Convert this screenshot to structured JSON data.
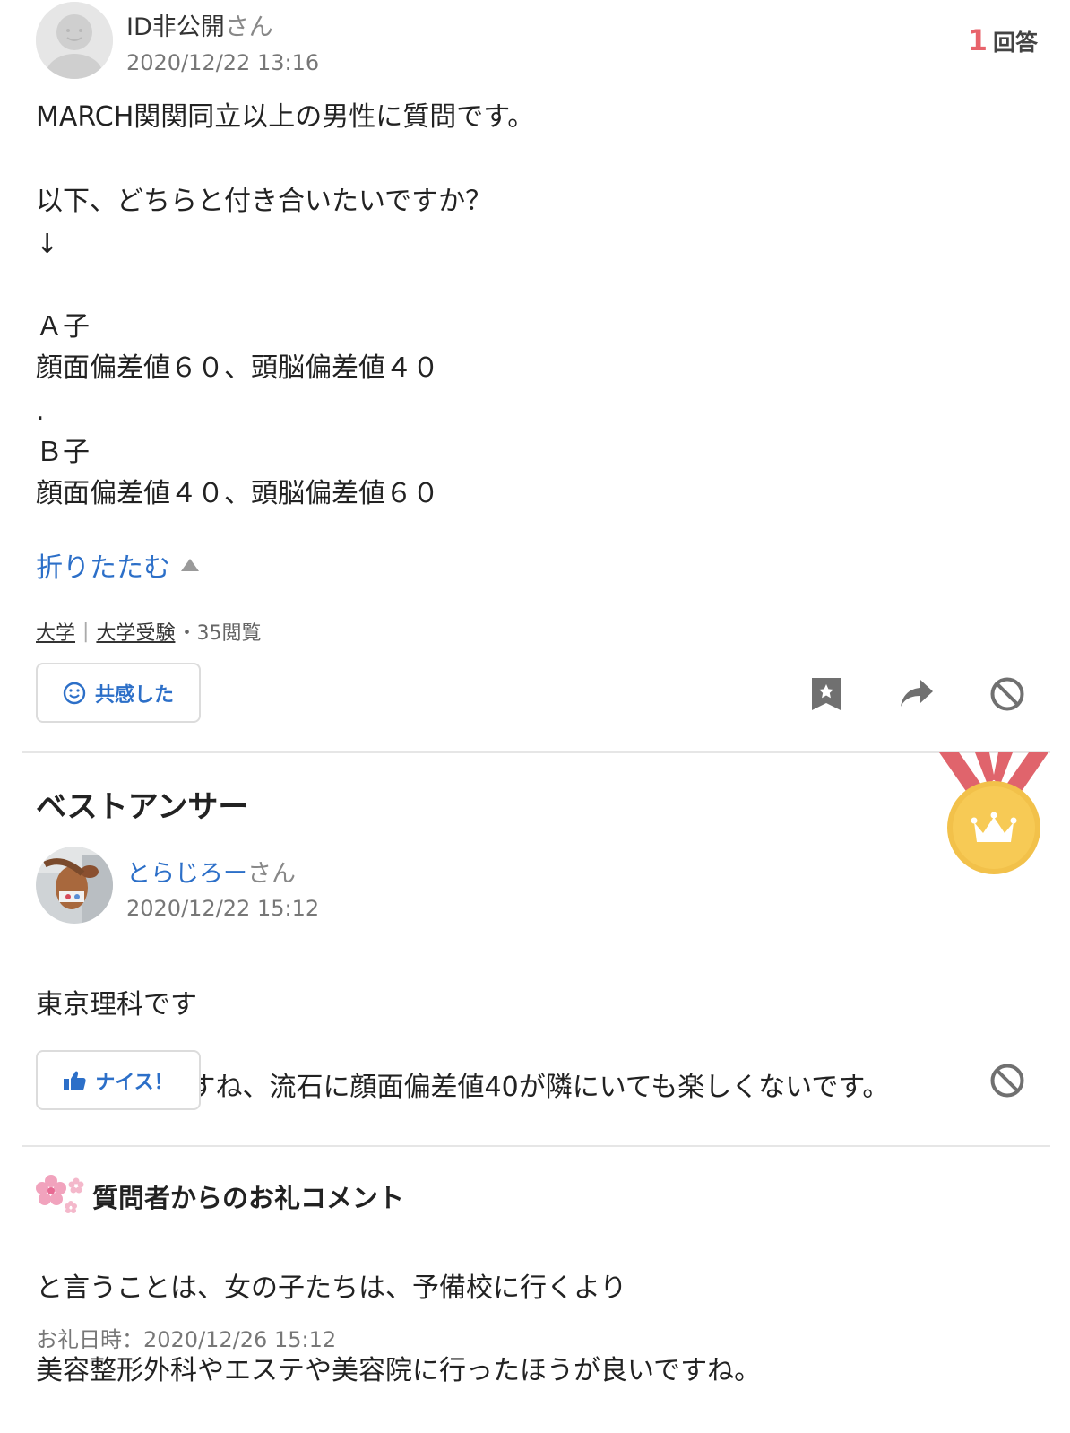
{
  "question": {
    "user_name": "ID非公開",
    "user_suffix": "さん",
    "timestamp": "2020/12/22 13:16",
    "answer_count": "1",
    "answer_label": "回答",
    "body_line1": "MARCH関関同立以上の男性に質問です。",
    "body_line2": "以下、どちらと付き合いたいですか？",
    "body_line3": "↓",
    "a_label": "Ａ子",
    "a_desc": "顔面偏差値６０、頭脳偏差値４０",
    "separator": ".",
    "b_label": "Ｂ子",
    "b_desc": "顔面偏差値４０、頭脳偏差値６０",
    "collapse_label": "折りたたむ",
    "category1": "大学",
    "category_sep": "|",
    "category2": "大学受験",
    "views": "・35閲覧",
    "empathy_label": "共感した"
  },
  "best_answer": {
    "heading": "ベストアンサー",
    "user_name": "とらじろー",
    "user_suffix": "さん",
    "timestamp": "2020/12/22 15:12",
    "body_line1": "東京理科です",
    "body_line2": "自分はA子ですね、流石に顔面偏差値40が隣にいても楽しくないです。",
    "nice_label": "ナイス！"
  },
  "thanks": {
    "heading": "質問者からのお礼コメント",
    "body_line1": "と言うことは、女の子たちは、予備校に行くより",
    "body_line2": "美容整形外科やエステや美容院に行ったほうが良いですね。",
    "date": "お礼日時：2020/12/26 15:12"
  },
  "colors": {
    "accent_blue": "#2c6fc8",
    "answer_count_red": "#e8636b",
    "medal_gold": "#f2c14a",
    "ribbon_red": "#e0646c"
  },
  "icons": [
    "default-avatar-icon",
    "smile-icon",
    "bookmark-icon",
    "share-arrow-icon",
    "block-icon",
    "medal-icon",
    "crown-icon",
    "thumbs-up-icon",
    "sakura-icon",
    "triangle-up-icon"
  ]
}
